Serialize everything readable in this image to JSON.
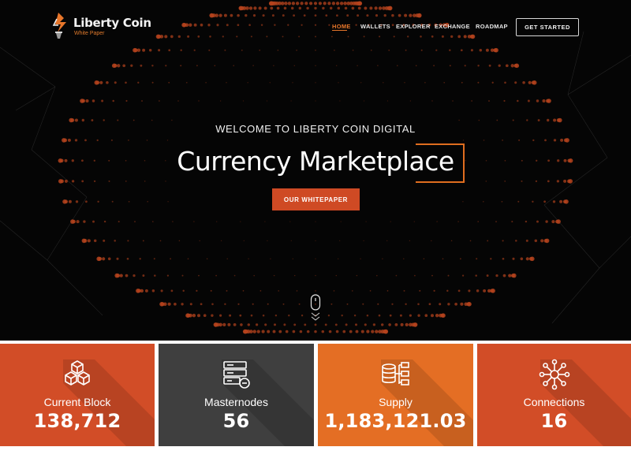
{
  "logo": {
    "title": "Liberty Coin",
    "subtitle": "White Paper",
    "icon": "liberty-torch-icon"
  },
  "nav": {
    "items": [
      {
        "label": "HOME",
        "active": true
      },
      {
        "label": "WALLETS",
        "active": false
      },
      {
        "label": "EXPLORER",
        "active": false
      },
      {
        "label": "EXCHANGE",
        "active": false
      },
      {
        "label": "ROADMAP",
        "active": false
      }
    ],
    "cta_label": "GET STARTED"
  },
  "hero": {
    "welcome": "WELCOME TO LIBERTY COIN DIGITAL",
    "headline": "Currency Marketplace",
    "button_label": "OUR WHITEPAPER",
    "scroll_icon": "mouse-scroll-icon"
  },
  "stats": [
    {
      "label": "Current Block",
      "value": "138,712",
      "icon": "cubes-icon",
      "color": "#d24d27"
    },
    {
      "label": "Masternodes",
      "value": "56",
      "icon": "server-remove-icon",
      "color": "#3f3f3f"
    },
    {
      "label": "Supply",
      "value": "1,183,121.03",
      "icon": "database-tree-icon",
      "color": "#e46e24"
    },
    {
      "label": "Connections",
      "value": "16",
      "icon": "network-hub-icon",
      "color": "#d24d27"
    }
  ],
  "colors": {
    "accent": "#e6762a",
    "button": "#cf4a24",
    "hero_background": "#050505"
  }
}
